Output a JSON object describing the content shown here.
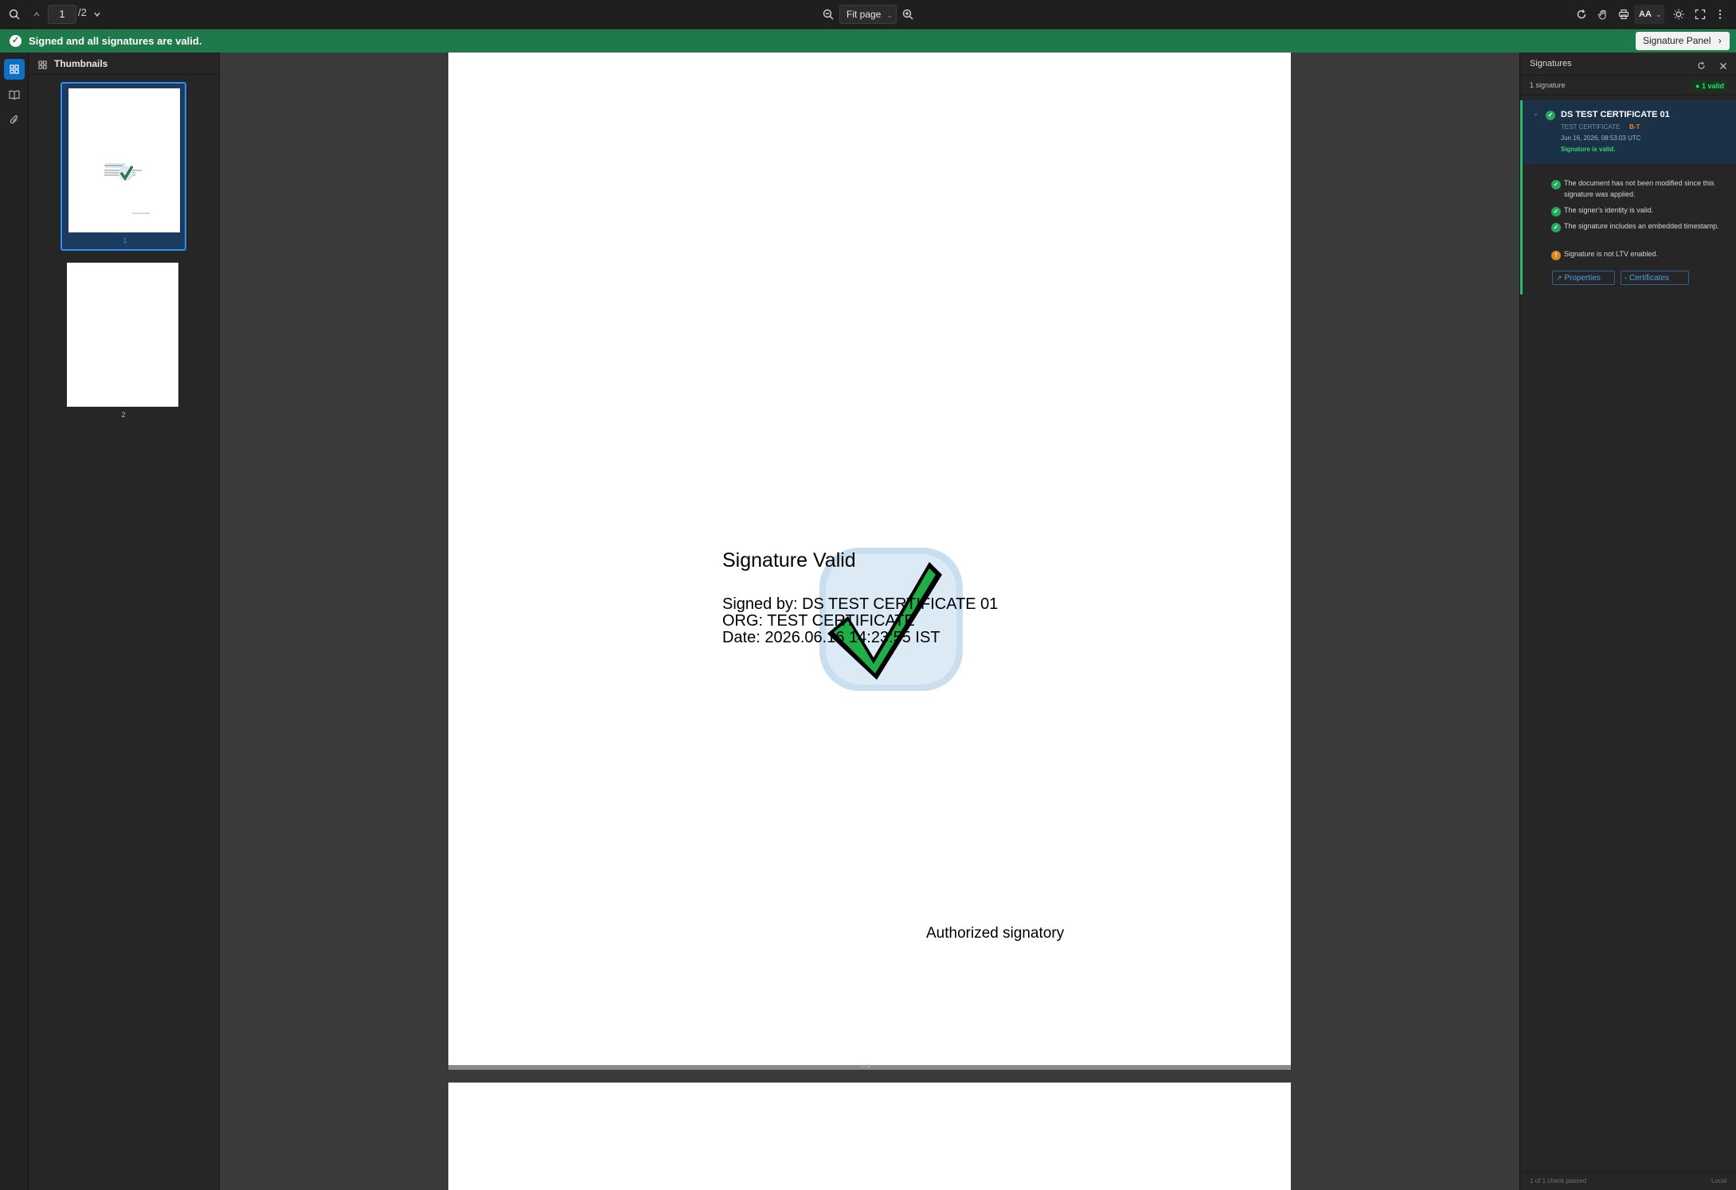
{
  "toolbar": {
    "page_current": "1",
    "page_total": "/2",
    "zoom": "Fit page",
    "aa_label": "AA"
  },
  "banner": {
    "message": "Signed and all signatures are valid.",
    "button_label": "Signature Panel"
  },
  "thumbnails": {
    "title": "Thumbnails",
    "pages": [
      {
        "label": "1",
        "selected": true
      },
      {
        "label": "2",
        "selected": false
      }
    ]
  },
  "document": {
    "page_indicator": "1 / 2",
    "signature_title": "Signature Valid",
    "signed_by": "Signed by: DS TEST CERTIFICATE 01",
    "org": "ORG: TEST CERTIFICATE",
    "date": "Date: 2026.06.16 14:23:55 IST",
    "authorized_label": "Authorized signatory"
  },
  "signatures_panel": {
    "title": "Signatures",
    "count_label": "1 signature",
    "valid_badge": "1 valid",
    "certificate": {
      "name": "DS TEST CERTIFICATE 01",
      "org": "TEST CERTIFICATE",
      "level": "B-T",
      "date": "Jun 16, 2026, 08:53:03 UTC",
      "status": "Signature is valid."
    },
    "checks": [
      {
        "text": "The document has not been modified since this signature was applied.",
        "state": "ok"
      },
      {
        "text": "The signer's identity is valid.",
        "state": "ok"
      },
      {
        "text": "The signature includes an embedded timestamp.",
        "state": "ok"
      },
      {
        "text": "Signature is not LTV enabled.",
        "state": "warn"
      }
    ],
    "properties_label": "Properties",
    "certificates_label": "Certificates",
    "footer_left": "1 of 1 check passed",
    "footer_right": "Local"
  },
  "colors": {
    "banner": "#1e7a4a",
    "accent": "#0e6fc6",
    "valid": "#22a75b",
    "warning": "#d9861c"
  }
}
